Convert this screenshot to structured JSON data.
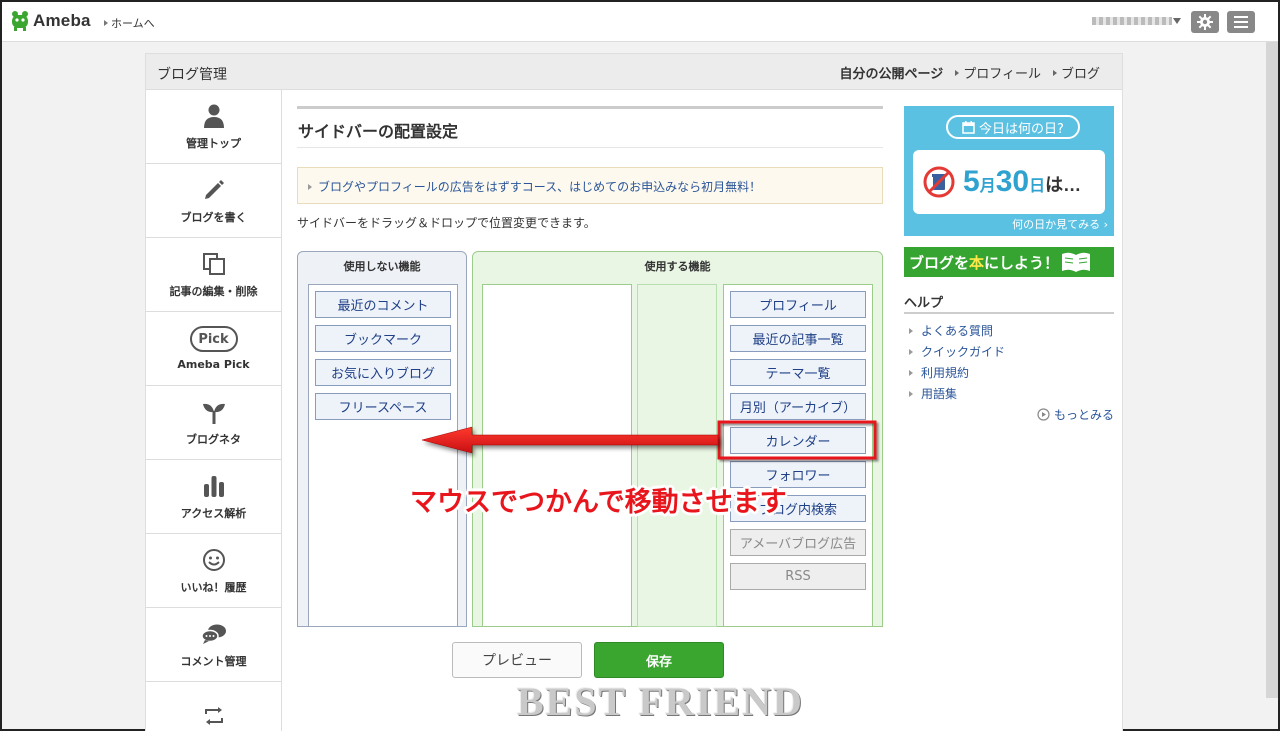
{
  "topbar": {
    "app_name": "Ameba",
    "home_link": "ホームへ"
  },
  "panel": {
    "title": "ブログ管理",
    "links": [
      "自分の公開ページ",
      "プロフィール",
      "ブログ"
    ]
  },
  "nav": [
    {
      "label": "管理トップ",
      "icon": "person-icon"
    },
    {
      "label": "ブログを書く",
      "icon": "pencil-icon"
    },
    {
      "label": "記事の編集・削除",
      "icon": "documents-icon"
    },
    {
      "label": "Ameba Pick",
      "icon": "pick-icon",
      "icon_text": "Pick"
    },
    {
      "label": "ブログネタ",
      "icon": "sprout-icon"
    },
    {
      "label": "アクセス解析",
      "icon": "bar-chart-icon"
    },
    {
      "label": "いいね！履歴",
      "icon": "smiley-icon"
    },
    {
      "label": "コメント管理",
      "icon": "comment-icon"
    },
    {
      "label": "",
      "icon": "reblog-icon"
    }
  ],
  "main": {
    "section_title": "サイドバーの配置設定",
    "ad_text": "ブログやプロフィールの広告をはずすコース、はじめてのお申込みなら初月無料！",
    "instruction": "サイドバーをドラッグ＆ドロップで位置変更できます。",
    "unused_header": "使用しない機能",
    "used_header": "使用する機能",
    "unused_modules": [
      "最近のコメント",
      "ブックマーク",
      "お気に入りブログ",
      "フリースペース"
    ],
    "used_modules": [
      "プロフィール",
      "最近の記事一覧",
      "テーマ一覧",
      "月別（アーカイブ）",
      "カレンダー",
      "フォロワー",
      "ブログ内検索"
    ],
    "disabled_modules": [
      "アメーバブログ広告",
      "RSS"
    ],
    "preview_label": "プレビュー",
    "save_label": "保存"
  },
  "right": {
    "today_pill": "今日は何の日?",
    "today_month_num": "5",
    "today_month_unit": "月",
    "today_day_num": "30",
    "today_day_unit": "日",
    "today_suffix": "は…",
    "today_link": "何の日か見てみる",
    "book_pre": "ブログを",
    "book_hon": "本",
    "book_post": "にしよう！",
    "help_title": "ヘルプ",
    "help_items": [
      "よくある質問",
      "クイックガイド",
      "利用規約",
      "用語集"
    ],
    "more_link": "もっとみる"
  },
  "annotation": {
    "text": "マウスでつかんで移動させます",
    "color": "#e8161c"
  },
  "watermark": "BEST FRIEND",
  "colors": {
    "save_green": "#3aa52f",
    "banner_blue": "#5bc1e3",
    "link_blue": "#2a5599"
  }
}
